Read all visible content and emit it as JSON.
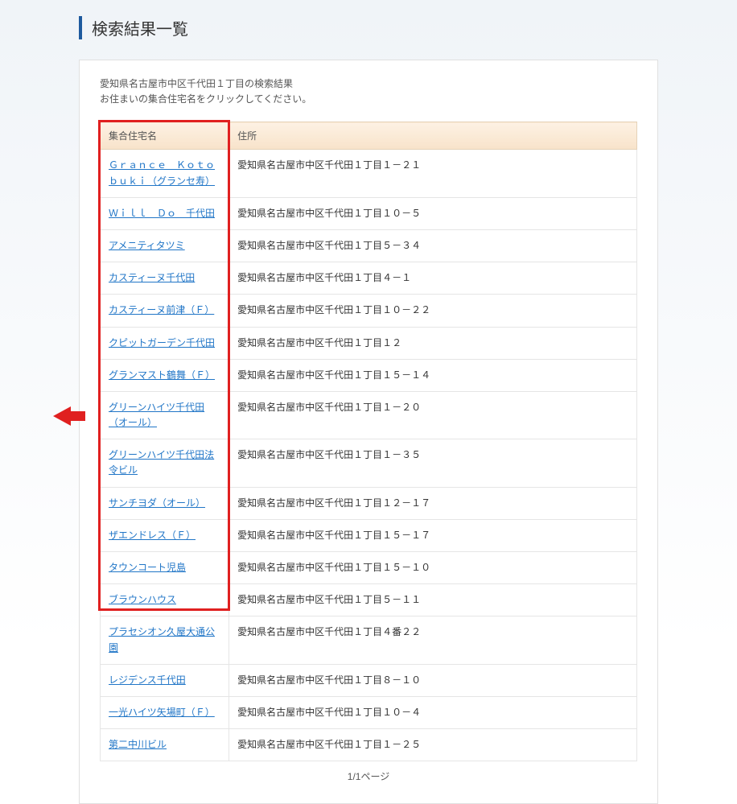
{
  "page_title": "検索結果一覧",
  "intro_line1": "愛知県名古屋市中区千代田１丁目の検索結果",
  "intro_line2": "お住まいの集合住宅名をクリックしてください。",
  "table": {
    "header_name": "集合住宅名",
    "header_address": "住所",
    "rows": [
      {
        "name": "Ｇｒａｎｃｅ　Ｋｏｔｏｂｕｋｉ（グランセ寿）",
        "address": "愛知県名古屋市中区千代田１丁目１－２１"
      },
      {
        "name": "Ｗｉｌｌ　Ｄｏ　千代田",
        "address": "愛知県名古屋市中区千代田１丁目１０－５"
      },
      {
        "name": "アメニティタツミ",
        "address": "愛知県名古屋市中区千代田１丁目５－３４"
      },
      {
        "name": "カスティーヌ千代田",
        "address": "愛知県名古屋市中区千代田１丁目４－１"
      },
      {
        "name": "カスティーヌ前津（Ｆ）",
        "address": "愛知県名古屋市中区千代田１丁目１０－２２"
      },
      {
        "name": "クピットガーデン千代田",
        "address": "愛知県名古屋市中区千代田１丁目１２"
      },
      {
        "name": "グランマスト鶴舞（Ｆ）",
        "address": "愛知県名古屋市中区千代田１丁目１５－１４"
      },
      {
        "name": "グリーンハイツ千代田（オール）",
        "address": "愛知県名古屋市中区千代田１丁目１－２０"
      },
      {
        "name": "グリーンハイツ千代田法令ビル",
        "address": "愛知県名古屋市中区千代田１丁目１－３５"
      },
      {
        "name": "サンチヨダ（オール）",
        "address": "愛知県名古屋市中区千代田１丁目１２－１７"
      },
      {
        "name": "ザエンドレス（Ｆ）",
        "address": "愛知県名古屋市中区千代田１丁目１５－１７"
      },
      {
        "name": "タウンコート児島",
        "address": "愛知県名古屋市中区千代田１丁目１５－１０"
      },
      {
        "name": "ブラウンハウス",
        "address": "愛知県名古屋市中区千代田１丁目５－１１"
      },
      {
        "name": "プラセシオン久屋大通公園",
        "address": "愛知県名古屋市中区千代田１丁目４番２２"
      },
      {
        "name": "レジデンス千代田",
        "address": "愛知県名古屋市中区千代田１丁目８－１０"
      },
      {
        "name": "一光ハイツ矢場町（Ｆ）",
        "address": "愛知県名古屋市中区千代田１丁目１０－４"
      },
      {
        "name": "第二中川ビル",
        "address": "愛知県名古屋市中区千代田１丁目１－２５"
      }
    ]
  },
  "pagination": "1/1ページ"
}
